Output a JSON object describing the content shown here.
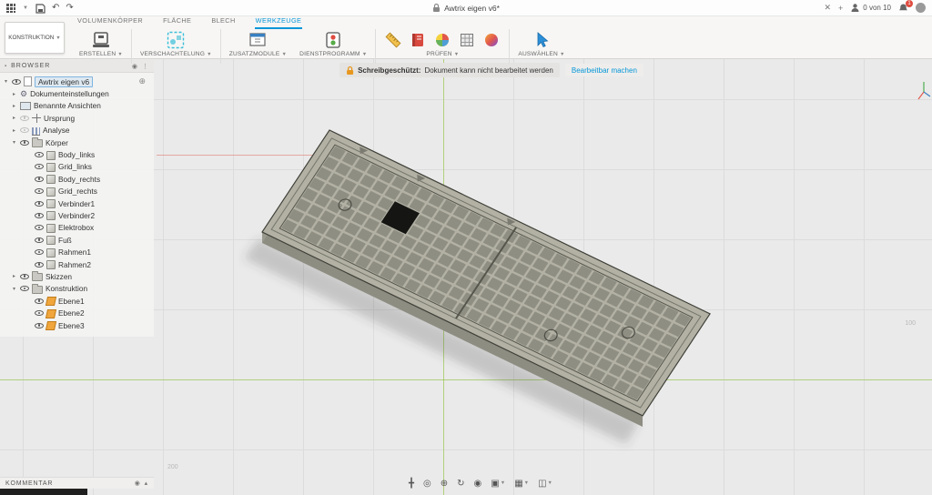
{
  "titlebar": {
    "title": "Awtrix eigen v6*",
    "close": "✕",
    "new_tab": "+",
    "quota": "0 von 10",
    "badge": "1",
    "undo": "↶",
    "redo": "↷"
  },
  "tabs": {
    "items": [
      {
        "label": "VOLUMENKÖRPER",
        "active": false
      },
      {
        "label": "FLÄCHE",
        "active": false
      },
      {
        "label": "BLECH",
        "active": false
      },
      {
        "label": "WERKZEUGE",
        "active": true
      }
    ]
  },
  "toolbar": {
    "workspace": "KONSTRUKTION",
    "groups": [
      {
        "label": "ERSTELLEN"
      },
      {
        "label": "VERSCHACHTELUNG"
      },
      {
        "label": "ZUSATZMODULE"
      },
      {
        "label": "DIENSTPROGRAMM"
      },
      {
        "label": "PRÜFEN"
      },
      {
        "label": "AUSWÄHLEN"
      }
    ]
  },
  "warning": {
    "title": "Schreibgeschützt:",
    "message": "Dokument kann nicht bearbeitet werden",
    "action": "Bearbeitbar machen"
  },
  "browser": {
    "header": "BROWSER",
    "root_label": "Awtrix eigen v6",
    "items": [
      {
        "label": "Dokumenteinstellungen",
        "level": 1,
        "icon": "gear",
        "arrow": "collapsed",
        "eye": ""
      },
      {
        "label": "Benannte Ansichten",
        "level": 1,
        "icon": "views",
        "arrow": "collapsed",
        "eye": ""
      },
      {
        "label": "Ursprung",
        "level": 1,
        "icon": "origin",
        "arrow": "collapsed",
        "eye": "dim"
      },
      {
        "label": "Analyse",
        "level": 1,
        "icon": "analysis",
        "arrow": "collapsed",
        "eye": "dim"
      },
      {
        "label": "Körper",
        "level": 1,
        "icon": "folder",
        "arrow": "expanded",
        "eye": "on"
      },
      {
        "label": "Body_links",
        "level": 2,
        "icon": "body",
        "arrow": "",
        "eye": "on"
      },
      {
        "label": "Grid_links",
        "level": 2,
        "icon": "body",
        "arrow": "",
        "eye": "on"
      },
      {
        "label": "Body_rechts",
        "level": 2,
        "icon": "body",
        "arrow": "",
        "eye": "on"
      },
      {
        "label": "Grid_rechts",
        "level": 2,
        "icon": "body",
        "arrow": "",
        "eye": "on"
      },
      {
        "label": "Verbinder1",
        "level": 2,
        "icon": "body",
        "arrow": "",
        "eye": "on"
      },
      {
        "label": "Verbinder2",
        "level": 2,
        "icon": "body",
        "arrow": "",
        "eye": "on"
      },
      {
        "label": "Elektrobox",
        "level": 2,
        "icon": "body",
        "arrow": "",
        "eye": "on"
      },
      {
        "label": "Fuß",
        "level": 2,
        "icon": "body",
        "arrow": "",
        "eye": "on"
      },
      {
        "label": "Rahmen1",
        "level": 2,
        "icon": "body",
        "arrow": "",
        "eye": "on"
      },
      {
        "label": "Rahmen2",
        "level": 2,
        "icon": "body",
        "arrow": "",
        "eye": "on"
      },
      {
        "label": "Skizzen",
        "level": 1,
        "icon": "folder",
        "arrow": "collapsed",
        "eye": "on"
      },
      {
        "label": "Konstruktion",
        "level": 1,
        "icon": "folder",
        "arrow": "expanded",
        "eye": "on"
      },
      {
        "label": "Ebene1",
        "level": 2,
        "icon": "plane",
        "arrow": "",
        "eye": "on"
      },
      {
        "label": "Ebene2",
        "level": 2,
        "icon": "plane",
        "arrow": "",
        "eye": "on"
      },
      {
        "label": "Ebene3",
        "level": 2,
        "icon": "plane",
        "arrow": "",
        "eye": "on"
      }
    ]
  },
  "comments": {
    "header": "KOMMENTAR"
  },
  "viewport": {
    "labels": [
      {
        "text": "100"
      },
      {
        "text": "200"
      }
    ]
  },
  "nav": {
    "icons": [
      {
        "name": "pan-icon",
        "glyph": "╋",
        "caret": false
      },
      {
        "name": "zoom-icon",
        "glyph": "◎",
        "caret": false
      },
      {
        "name": "fit-icon",
        "glyph": "⊕",
        "caret": false
      },
      {
        "name": "orbit-icon",
        "glyph": "↻",
        "caret": false
      },
      {
        "name": "look-at-icon",
        "glyph": "◉",
        "caret": false
      },
      {
        "name": "display-settings-icon",
        "glyph": "▣",
        "caret": true
      },
      {
        "name": "grid-settings-icon",
        "glyph": "▦",
        "caret": true
      },
      {
        "name": "viewports-icon",
        "glyph": "◫",
        "caret": true
      }
    ]
  }
}
